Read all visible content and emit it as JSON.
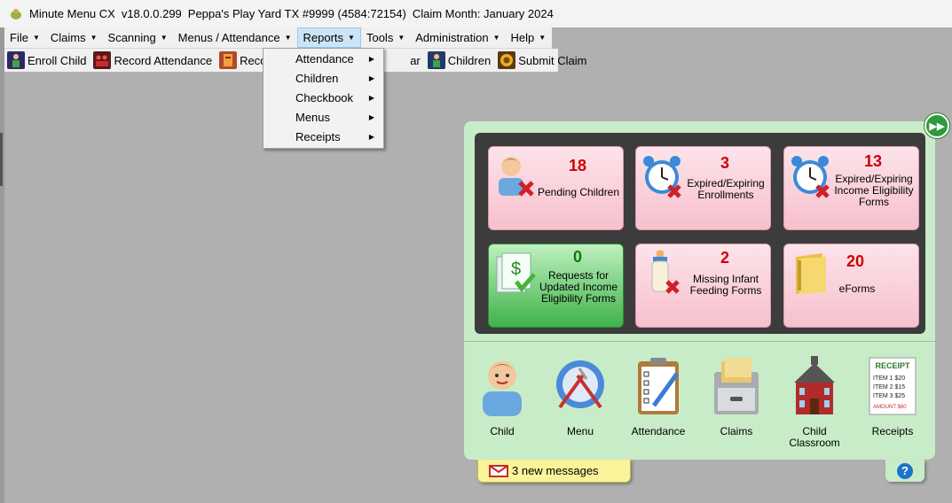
{
  "titlebar": {
    "app_name": "Minute Menu CX",
    "version": "v18.0.0.299",
    "location": "Peppa's Play Yard TX #9999 (4584:72154)",
    "claim_month": "Claim Month: January 2024"
  },
  "menubar": {
    "items": [
      "File",
      "Claims",
      "Scanning",
      "Menus / Attendance",
      "Reports",
      "Tools",
      "Administration",
      "Help"
    ],
    "active": "Reports"
  },
  "toolbar": {
    "enroll_child": "Enroll Child",
    "record_attendance": "Record Attendance",
    "record_partial": "Record I",
    "hidden_suffix": "ar",
    "children": "Children",
    "submit_claim": "Submit Claim"
  },
  "reports_menu": {
    "items": [
      "Attendance",
      "Children",
      "Checkbook",
      "Menus",
      "Receipts"
    ]
  },
  "tiles": [
    {
      "count": "18",
      "label": "Pending Children",
      "icon": "pending-child-icon"
    },
    {
      "count": "3",
      "label": "Expired/Expiring Enrollments",
      "icon": "alarm-clock-icon"
    },
    {
      "count": "13",
      "label": "Expired/Expiring Income Eligibility Forms",
      "icon": "alarm-clock-icon"
    },
    {
      "count": "0",
      "label": "Requests for Updated Income Eligibility Forms",
      "icon": "dollar-document-icon"
    },
    {
      "count": "2",
      "label": "Missing Infant Feeding Forms",
      "icon": "baby-bottle-icon"
    },
    {
      "count": "20",
      "label": "eForms",
      "icon": "folder-icon"
    }
  ],
  "nav": {
    "child": "Child",
    "menu": "Menu",
    "attendance": "Attendance",
    "claims": "Claims",
    "child_classroom": "Child Classroom",
    "receipts": "Receipts"
  },
  "receipt_icon_text": {
    "title": "RECEIPT",
    "line1": "ITEM 1 $20",
    "line2": "ITEM 2 $15",
    "line3": "ITEM 3 $25",
    "amount": "AMOUNT $60"
  },
  "messages": "3 new messages",
  "help_symbol": "?",
  "colors": {
    "alert_red": "#cc0000",
    "ok_green": "#0a7a0a",
    "panel_green": "#c9ecc8"
  }
}
